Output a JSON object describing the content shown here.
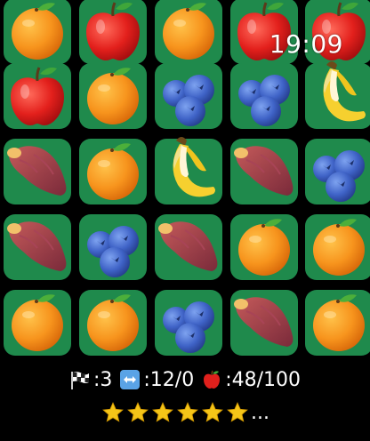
{
  "status": {
    "time": "19:09"
  },
  "board": {
    "rows": [
      [
        "orange",
        "apple",
        "orange",
        "apple",
        "apple"
      ],
      [
        "apple",
        "orange",
        "blueberry",
        "blueberry",
        "banana"
      ],
      [
        "sweet-potato",
        "orange",
        "banana",
        "sweet-potato",
        "blueberry"
      ],
      [
        "sweet-potato",
        "blueberry",
        "sweet-potato",
        "orange",
        "orange"
      ],
      [
        "orange",
        "orange",
        "blueberry",
        "sweet-potato",
        "orange"
      ]
    ]
  },
  "stats": {
    "level_icon": "checkered-flag-icon",
    "level": ":3",
    "swaps_icon": "swap-arrows-icon",
    "swaps": ":12/0",
    "score_icon": "apple-icon",
    "score": ":48/100"
  },
  "rating": {
    "star_icon": "star-icon",
    "stars_shown": 6,
    "ellipsis": "..."
  },
  "colors": {
    "tile_green": "#1f8a4c",
    "background": "#000000",
    "star": "#f5c518"
  }
}
